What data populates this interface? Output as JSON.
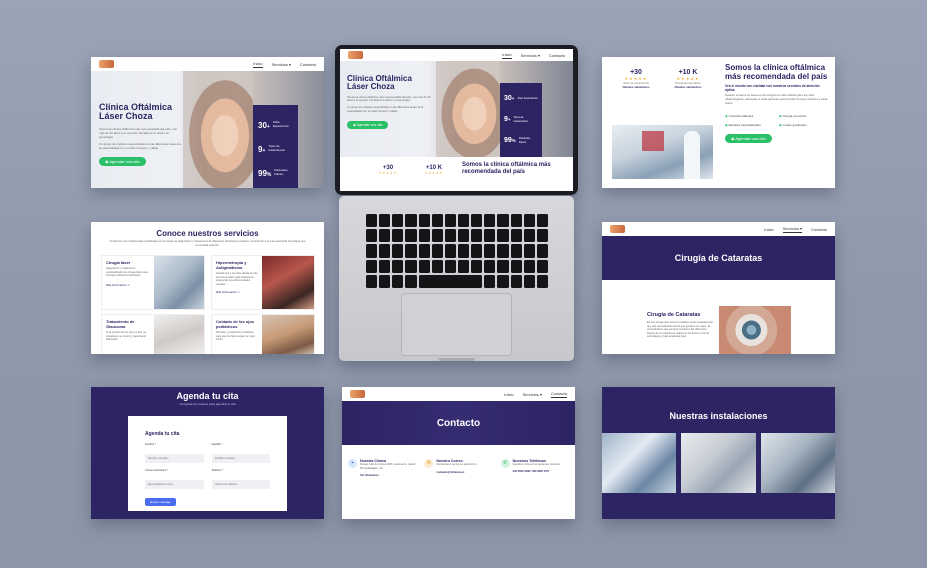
{
  "brand_colors": {
    "primary": "#2c2463",
    "accent": "#2bbf68",
    "star": "#f2b33c"
  },
  "nav": {
    "home": "Inicio",
    "services": "Servicios",
    "contact": "Contacto"
  },
  "hero": {
    "title_line1": "Clínica Oftálmica",
    "title_line2": "Láser Choza",
    "paragraph1": "Somos la clínica oftálmica más recomendada del país, con más de 30 años a tu servicio, brindamos lo último en tecnología.",
    "paragraph2": "Un grupo de médicos especialistas en las diferentes áreas de la especialidad con un trato humano y cálido.",
    "cta": "Agendar una cita",
    "stats": [
      {
        "number": "30",
        "suffix": "+",
        "label": "Años Experiencia"
      },
      {
        "number": "9",
        "suffix": "+",
        "label": "Tipos de tratamientos"
      },
      {
        "number": "99",
        "suffix": "%",
        "label": "Pacientes felices"
      }
    ]
  },
  "about": {
    "stat1_number": "+30",
    "stat1_label": "años de experiencia",
    "stat1_sub": "Clientes satisfechos",
    "stat2_number": "+10 K",
    "stat2_label": "Pacientes atendidos",
    "stat2_sub": "Clientes satisfechos",
    "title": "Somos la clínica oftálmica más recomendada del país",
    "subtitle": "Ven el mundo con claridad con nuestros servicios de atención óptica.",
    "body": "Nuestro enfoque se basa en tecnología con alta calidad para tus citas oftalmológicas, adecuado a cada paciente para brindar la mejor solución a cada visión.",
    "features": [
      "Consulta oftálmica",
      "Cirugía correctiva",
      "Estudios especializados",
      "Lentes graduados"
    ],
    "cta": "Agendar una cita"
  },
  "services": {
    "title": "Conoce nuestros servicios",
    "intro": "Contamos con profesionales acreditados en las áreas de diagnóstico y tratamiento de diferentes afecciones oculares, recurriendo a la más avanzada tecnología que te brindará solución.",
    "items": [
      {
        "title": "Cirugía láser",
        "text": "Diagnóstico y tratamiento personalizado con cirugía láser para corregir problemas refractivos.",
        "link": "Más información"
      },
      {
        "title": "Hipermetropía y Astigmatismo",
        "text": "Atendemos a tus hijos desde la más temprana edad, para tratamiento integral de sus enfermedades visuales.",
        "link": "Más información"
      },
      {
        "title": "Tratamiento de Glaucoma",
        "text": "Si la presión de tus ojos es alta, es importante un control y tratamiento adecuado.",
        "link": ""
      },
      {
        "title": "Cuidado de los ojos pediátricos",
        "text": "Revisión y tratamiento pediátrico para que tus hijos tengan la mejor visión.",
        "link": ""
      }
    ]
  },
  "cataract": {
    "banner": "Cirugía de Cataratas",
    "section_title": "Cirugía de Cataratas",
    "text": "Es una cirugía que retira el cristalino opaco (catarata) del ojo, que reemplaza de forma que ayuda a ver mejor. El procedimiento que siempre conducen las diferentes etapas de su práctica se realiza en la clínica en forma ambulatoria y bajo anestesia local."
  },
  "appointment": {
    "title": "Agenda tu cita",
    "subtitle": "Completa los campos para agendar tu cita",
    "form_title": "Agenda tu cita",
    "fields": [
      {
        "label": "Nombre *",
        "placeholder": "Nombre completo"
      },
      {
        "label": "Apellido *",
        "placeholder": "Apellido completo"
      },
      {
        "label": "Correo electrónico *",
        "placeholder": "Ejemplo@correo.com"
      },
      {
        "label": "Teléfono *",
        "placeholder": "Número de teléfono"
      }
    ],
    "submit": "Enviar mensaje"
  },
  "contact": {
    "banner": "Contacto",
    "items": [
      {
        "title": "Nuestra Clínica",
        "text": "Pasaje Julio de Cortes 2660, esquina Av. Juárez 83 Guadalajara, Jal.",
        "link": "Ver Ubicación",
        "icon": "location-icon"
      },
      {
        "title": "Nuestro Correo",
        "text": "Contáctanos vía correo electrónico",
        "link": "contacto@clinicasoo",
        "icon": "mail-icon"
      },
      {
        "title": "Nuestros Teléfonos",
        "text": "Agenda tu cita en los siguientes números",
        "link": "333 3600 1080 / 333 3600 1077",
        "icon": "phone-icon"
      }
    ]
  },
  "facilities": {
    "title": "Nuestras instalaciones"
  }
}
